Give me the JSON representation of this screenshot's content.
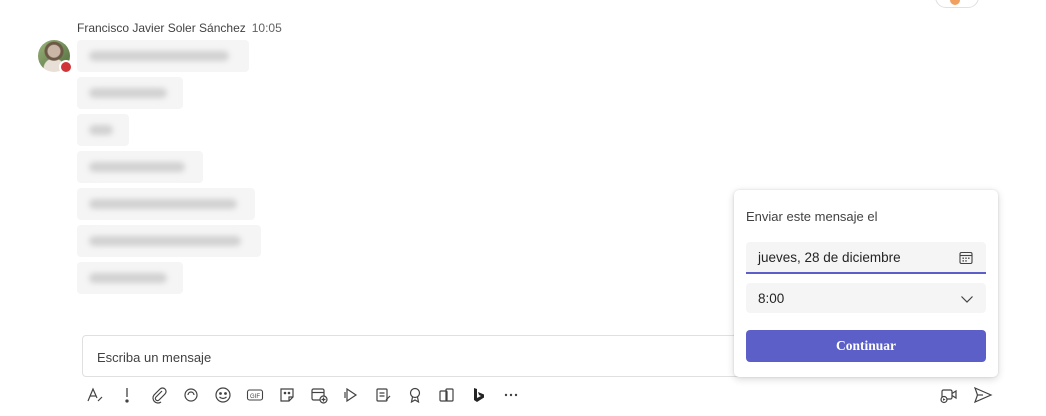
{
  "message": {
    "sender": "Francisco Javier Soler Sánchez",
    "time": "10:05",
    "presence_color": "#d13438"
  },
  "compose": {
    "placeholder": "Escriba un mensaje"
  },
  "toolbar": {
    "icons": [
      "format-icon",
      "important-icon",
      "attach-icon",
      "loop-icon",
      "emoji-icon",
      "gif-icon",
      "sticker-icon",
      "schedule-meeting-icon",
      "stream-icon",
      "forms-icon",
      "praise-icon",
      "approvals-icon",
      "bing-icon",
      "more-icon"
    ],
    "right_icons": [
      "video-clip-icon",
      "send-icon"
    ]
  },
  "schedule_popup": {
    "title": "Enviar este mensaje el",
    "date_value": "jueves, 28 de diciembre",
    "time_value": "8:00",
    "continue_label": "Continuar",
    "accent_color": "#5b5fc7"
  }
}
